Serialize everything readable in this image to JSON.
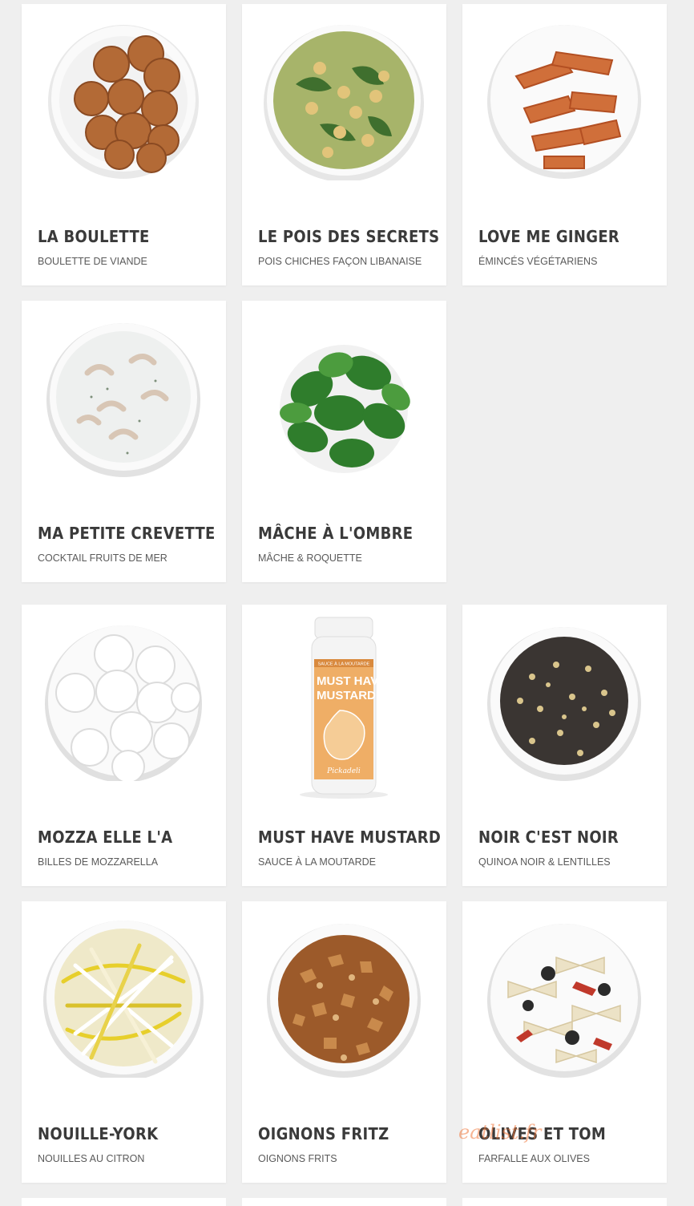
{
  "products": [
    {
      "title": "LA BOULETTE",
      "subtitle": "BOULETTE DE VIANDE",
      "image": "meatballs-bowl"
    },
    {
      "title": "LE POIS DES SECRETS",
      "subtitle": "POIS CHICHES FAÇON LIBANAISE",
      "image": "chickpea-salad-bowl"
    },
    {
      "title": "LOVE ME GINGER",
      "subtitle": "ÉMINCÉS VÉGÉTARIENS",
      "image": "ginger-strips-bowl"
    },
    {
      "title": "MA PETITE CREVETTE",
      "subtitle": "COCKTAIL FRUITS DE MER",
      "image": "shrimp-cocktail-bowl"
    },
    {
      "title": "MÂCHE À L'OMBRE",
      "subtitle": "MÂCHE & ROQUETTE",
      "image": "greens-bowl"
    },
    {
      "title": "MOZZA ELLE L'A",
      "subtitle": "BILLES DE MOZZARELLA",
      "image": "mozzarella-balls-bowl"
    },
    {
      "title": "MUST HAVE MUSTARD",
      "subtitle": "SAUCE À LA MOUTARDE",
      "image": "mustard-sauce-bottle",
      "bottle": {
        "label_top": "SAUCE À LA MOUTARDE",
        "label_line1": "MUST HAVE",
        "label_line2": "MUSTARD",
        "brand": "Pickadeli"
      }
    },
    {
      "title": "NOIR C'EST NOIR",
      "subtitle": "QUINOA NOIR & LENTILLES",
      "image": "quinoa-lentils-bowl"
    },
    {
      "title": "NOUILLE-YORK",
      "subtitle": "NOUILLES AU CITRON",
      "image": "lemon-noodles-bowl"
    },
    {
      "title": "OIGNONS FRITZ",
      "subtitle": "OIGNONS FRITS",
      "image": "fried-onions-bowl"
    },
    {
      "title": "OLIVES ET TOM",
      "subtitle": "FARFALLE AUX OLIVES",
      "image": "farfalle-olives-bowl"
    }
  ],
  "watermark": "eatlist.fr",
  "colors": {
    "background": "#efefef",
    "card": "#ffffff",
    "title": "#3a3a3a",
    "subtitle": "#5a5a5a"
  }
}
